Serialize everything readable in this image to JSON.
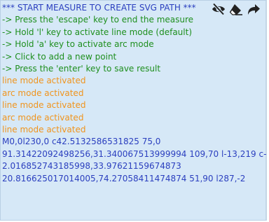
{
  "header": {
    "title": "*** START MEASURE TO CREATE SVG PATH ***"
  },
  "instructions": [
    "-> Press the 'escape' key to end the measure",
    "-> Hold 'l' key to activate line mode (default)",
    "-> Hold 'a' key to activate arc mode",
    "-> Click to add a new point",
    "-> Press the 'enter' key to save result"
  ],
  "log": [
    "line mode activated",
    "arc mode activated",
    "line mode activated",
    "arc mode activated",
    "line mode activated"
  ],
  "output": {
    "path_lines": [
      "M0,0l230,0 c42.5132586531825 75,0",
      "91.31422092498256,31.340067513999994 109,70 l-13,219 c-",
      "2.016852743185998,33.97621159674873",
      "20.816625017014005,74.27058411474874 51,90 l287,-2"
    ]
  },
  "toolbar": {
    "icons": [
      "eye-slash-icon",
      "eraser-icon",
      "redo-arrow-icon"
    ]
  },
  "colors": {
    "instruction": "#1e8f1e",
    "log": "#f0941d",
    "output": "#2b3fbf",
    "background": "#d6e8f7"
  }
}
